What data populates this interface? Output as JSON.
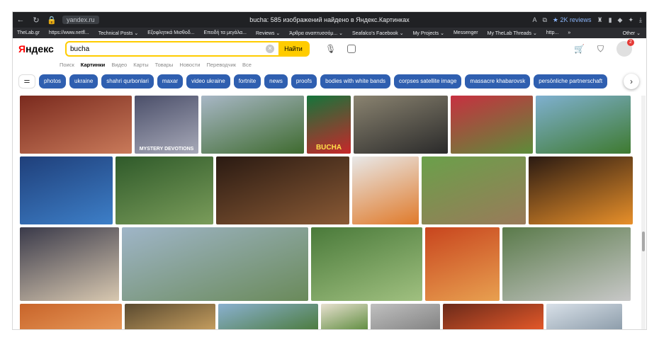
{
  "browser": {
    "url": "yandex.ru",
    "title": "bucha: 585 изображений найдено в Яндекс.Картинках",
    "reviews": "★ 2K reviews"
  },
  "bookmarks": [
    "TheLab.gr",
    "https://www.netfl...",
    "Technical Posts ⌄",
    "Εξοφλητικά Μισθοδ...",
    "Επειδή τα μεγάλα...",
    "Reviews ⌄",
    "Άρθρα αναπτυσσόμ... ⌄",
    "Seafalco's Facebook ⌄",
    "My Projects ⌄",
    "Messenger",
    "My TheLab Threads ⌄",
    "http...",
    "»"
  ],
  "bookmarks_other": "Other ⌄",
  "header": {
    "logo_red": "Я",
    "logo_black": "ндекс",
    "query": "bucha",
    "find_label": "Найти",
    "notifications": "2"
  },
  "tabs": [
    "Поиск",
    "Картинки",
    "Видео",
    "Карты",
    "Товары",
    "Новости",
    "Переводчик",
    "Все"
  ],
  "active_tab": "Картинки",
  "chips": [
    "photos",
    "ukraine",
    "shahri qurbonlari",
    "maxar",
    "video ukraine",
    "fortnite",
    "news",
    "proofs",
    "bodies with white bands",
    "corpses satellite image",
    "massacre khabarovsk",
    "persönliche partnerschaft"
  ],
  "images": {
    "row1": [
      {
        "name": "sliced-meat-board",
        "c1": "#7a2a1e",
        "c2": "#c97a5a"
      },
      {
        "name": "mystery-album-art",
        "c1": "#4b4f6a",
        "c2": "#a7a9b8",
        "caption": "MYSTERY DEVOTIONS"
      },
      {
        "name": "stadium-city",
        "c1": "#a8b7c6",
        "c2": "#3f6b2f"
      },
      {
        "name": "bucha-poster",
        "c1": "#14753b",
        "c2": "#c8272a",
        "caption": "BUCHA"
      },
      {
        "name": "man-glasses",
        "c1": "#8a8370",
        "c2": "#2a2a2a"
      },
      {
        "name": "red-roof-building",
        "c1": "#c73040",
        "c2": "#5d8c3a"
      },
      {
        "name": "park-pond",
        "c1": "#7fb0d0",
        "c2": "#3e7a2f"
      }
    ],
    "row2": [
      {
        "name": "concert-mountain",
        "c1": "#1f3f7a",
        "c2": "#3d7fc8"
      },
      {
        "name": "garden-house",
        "c1": "#2f5a2a",
        "c2": "#7a9c5a"
      },
      {
        "name": "grilled-steak",
        "c1": "#2a1a12",
        "c2": "#8a5a35"
      },
      {
        "name": "kombucha-bottles",
        "c1": "#e8e8e8",
        "c2": "#e07a2a"
      },
      {
        "name": "easy-bucha-bottle",
        "c1": "#6aa04a",
        "c2": "#9a7a5a"
      },
      {
        "name": "sunset-temple",
        "c1": "#2a1a12",
        "c2": "#e8902a"
      }
    ],
    "row3": [
      {
        "name": "cafe-interior",
        "c1": "#3a3a4a",
        "c2": "#d8c8b0"
      },
      {
        "name": "aerial-city",
        "c1": "#9fb5c8",
        "c2": "#6a8a5a"
      },
      {
        "name": "park-trees",
        "c1": "#4a7a3a",
        "c2": "#a0c080"
      },
      {
        "name": "bottles-red-orange",
        "c1": "#c8451e",
        "c2": "#e8a050"
      },
      {
        "name": "memorial-path",
        "c1": "#5a7a4a",
        "c2": "#c8c8c8"
      }
    ],
    "row4": [
      {
        "name": "orange-building",
        "c1": "#c8642a",
        "c2": "#e89a5a"
      },
      {
        "name": "food-bowls",
        "c1": "#5a4a30",
        "c2": "#c8a060"
      },
      {
        "name": "forest-sky",
        "c1": "#8ab0d0",
        "c2": "#4a7a3a"
      },
      {
        "name": "salad-plate",
        "c1": "#e8e0d0",
        "c2": "#5a8a3a"
      },
      {
        "name": "gray-object",
        "c1": "#c0c0c0",
        "c2": "#808080"
      },
      {
        "name": "candles",
        "c1": "#6a2a1a",
        "c2": "#e85a2a"
      },
      {
        "name": "white-building",
        "c1": "#d8e0e8",
        "c2": "#8a9aa8"
      }
    ]
  }
}
